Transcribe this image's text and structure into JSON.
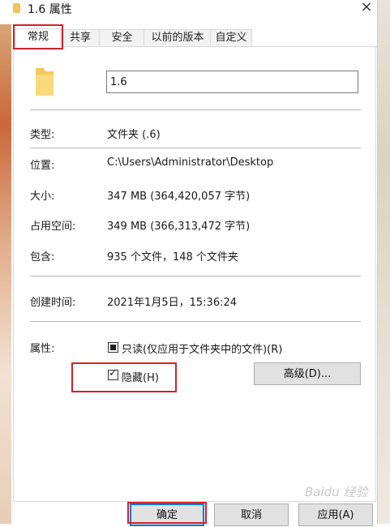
{
  "window": {
    "title": "1.6 属性",
    "close_label": "×"
  },
  "tabs": [
    "常规",
    "共享",
    "安全",
    "以前的版本",
    "自定义"
  ],
  "folder": {
    "name": "1.6"
  },
  "properties": {
    "type_label": "类型:",
    "type_value": "文件夹 (.6)",
    "location_label": "位置:",
    "location_value": "C:\\Users\\Administrator\\Desktop",
    "size_label": "大小:",
    "size_value": "347 MB (364,420,057 字节)",
    "disk_size_label": "占用空间:",
    "disk_size_value": "349 MB (366,313,472 字节)",
    "contains_label": "包含:",
    "contains_value": "935 个文件，148 个文件夹",
    "created_label": "创建时间:",
    "created_value": "2021年1月5日，15:36:24",
    "attributes_label": "属性:"
  },
  "attributes": {
    "readonly_label": "只读(仅应用于文件夹中的文件)(R)",
    "readonly_state": "indeterminate",
    "hidden_label": "隐藏(H)",
    "hidden_checked": true,
    "advanced_label": "高级(D)..."
  },
  "buttons": {
    "ok": "确定",
    "cancel": "取消",
    "apply": "应用(A)"
  },
  "watermark": "Baidu 经验",
  "colors": {
    "highlight": "#d0222a",
    "folder": "#f1c55a",
    "focus": "#0078d7"
  }
}
